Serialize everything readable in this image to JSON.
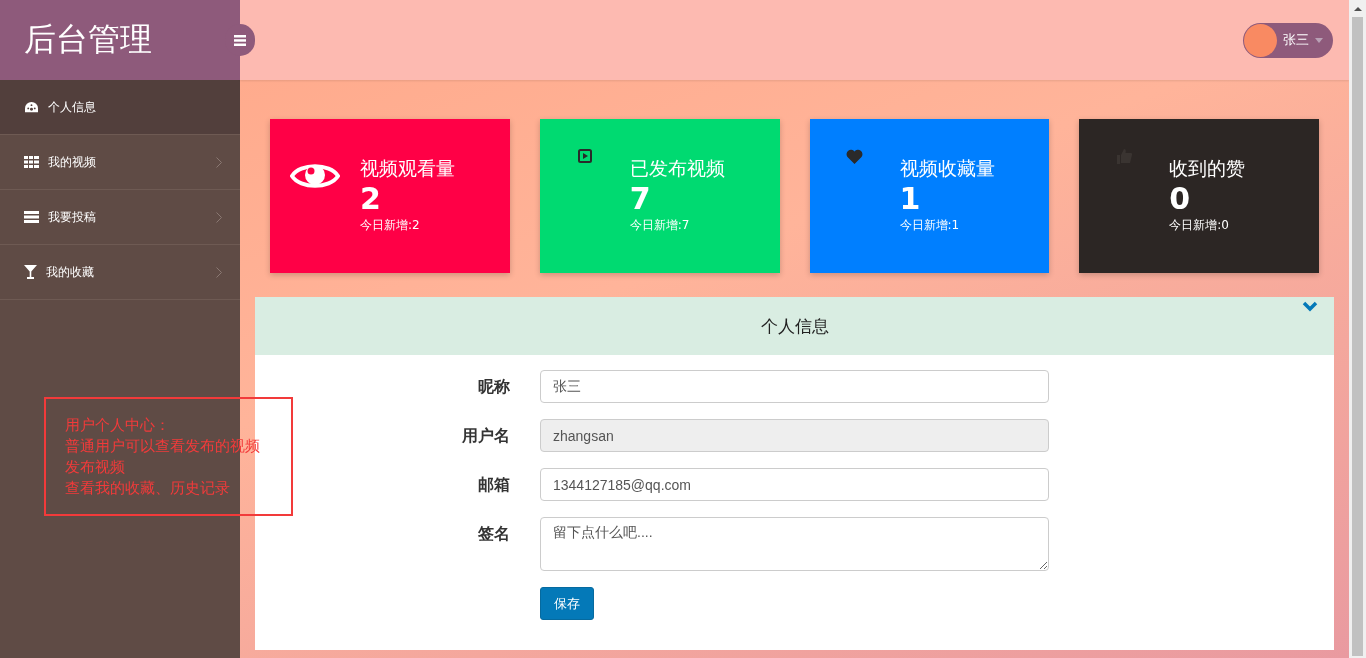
{
  "sidebar": {
    "brand": "后台管理",
    "items": [
      {
        "label": "个人信息",
        "selected": true,
        "has_submenu": false
      },
      {
        "label": "我的视频",
        "selected": false,
        "has_submenu": true
      },
      {
        "label": "我要投稿",
        "selected": false,
        "has_submenu": true
      },
      {
        "label": "我的收藏",
        "selected": false,
        "has_submenu": true
      }
    ]
  },
  "header": {
    "user": "张三"
  },
  "stats": [
    {
      "title": "视频观看量",
      "value": "2",
      "today": "今日新增:2",
      "color": "#ff0046"
    },
    {
      "title": "已发布视频",
      "value": "7",
      "today": "今日新增:7",
      "color": "#00da71"
    },
    {
      "title": "视频收藏量",
      "value": "1",
      "today": "今日新增:1",
      "color": "#007fff"
    },
    {
      "title": "收到的赞",
      "value": "0",
      "today": "今日新增:0",
      "color": "#2c2624"
    }
  ],
  "profile": {
    "title": "个人信息",
    "fields": [
      {
        "label": "昵称",
        "kind": "input",
        "value": "张三",
        "disabled": false
      },
      {
        "label": "用户名",
        "kind": "input",
        "value": "zhangsan",
        "disabled": true
      },
      {
        "label": "邮箱",
        "kind": "input",
        "value": "1344127185@qq.com",
        "disabled": false
      },
      {
        "label": "签名",
        "kind": "textarea",
        "placeholder": "留下点什么吧....",
        "disabled": false
      }
    ],
    "save": "保存"
  },
  "annotation": {
    "lines": [
      "用户个人中心：",
      "普通用户可以查看发布的视频",
      "发布视频",
      "查看我的收藏、历史记录"
    ]
  }
}
